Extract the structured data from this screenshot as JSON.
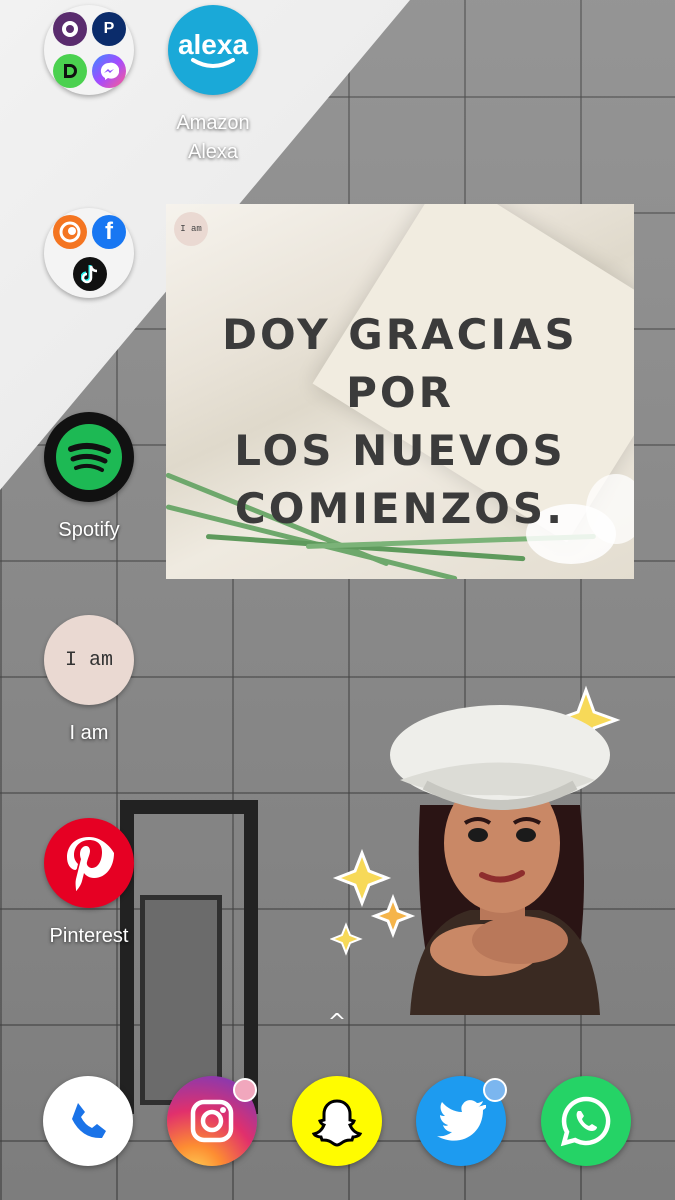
{
  "home": {
    "apps": [
      {
        "label": "Amazon\nAlexa",
        "icon_text": "alexa"
      },
      {
        "label": "Spotify"
      },
      {
        "label": "I am",
        "icon_text": "I am"
      },
      {
        "label": "Pinterest"
      }
    ],
    "folders": [
      {
        "name": "folder-1",
        "apps": [
          "Swiggy",
          "PayPal",
          "Dailyhunt",
          "Messenger"
        ]
      },
      {
        "name": "folder-2",
        "apps": [
          "Crunchyroll",
          "Facebook",
          "TikTok"
        ]
      }
    ]
  },
  "widget": {
    "badge_text": "I am",
    "quote_lines": [
      "DOY GRACIAS POR",
      "LOS NUEVOS",
      "COMIENZOS."
    ]
  },
  "drawer_hint": "^",
  "dock": [
    {
      "name": "phone"
    },
    {
      "name": "instagram",
      "badge": true
    },
    {
      "name": "snapchat"
    },
    {
      "name": "twitter",
      "badge": true
    },
    {
      "name": "whatsapp"
    }
  ],
  "colors": {
    "alexa": "#1aa9d8",
    "spotify": "#1db954",
    "pinterest": "#e60023",
    "iam_bg": "#ead9d2",
    "twitter": "#1d9bf0",
    "whatsapp": "#25d366",
    "snapchat": "#fffc00",
    "badge": "#f1a7bd"
  }
}
